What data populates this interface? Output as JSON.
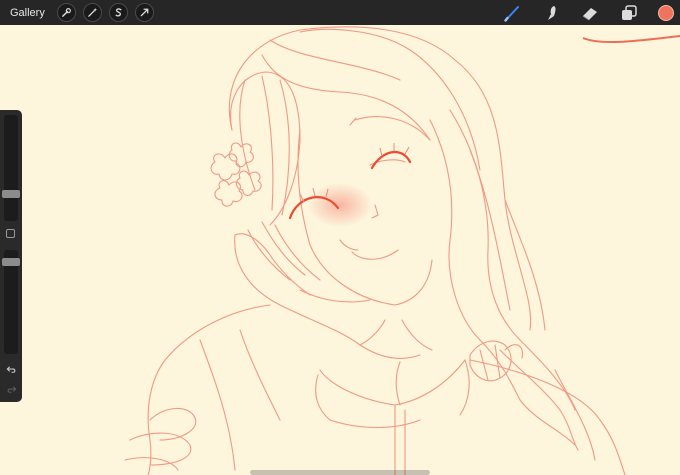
{
  "toolbar": {
    "gallery_label": "Gallery",
    "left_tools": [
      "wrench-icon",
      "magic-wand-icon",
      "selection-s-icon",
      "transform-arrow-icon"
    ],
    "right_tools": [
      "brush-icon",
      "smudge-icon",
      "eraser-icon",
      "layers-icon"
    ],
    "current_color": "#f0735e",
    "brush_active_color": "#3b82f6"
  },
  "sidebar": {
    "brush_size_level": 0.55,
    "opacity_level": 0.9
  },
  "canvas": {
    "background_color": "#fdf5dc",
    "stroke_color": "#ee8a76",
    "blush_color": "#f7a08e"
  }
}
